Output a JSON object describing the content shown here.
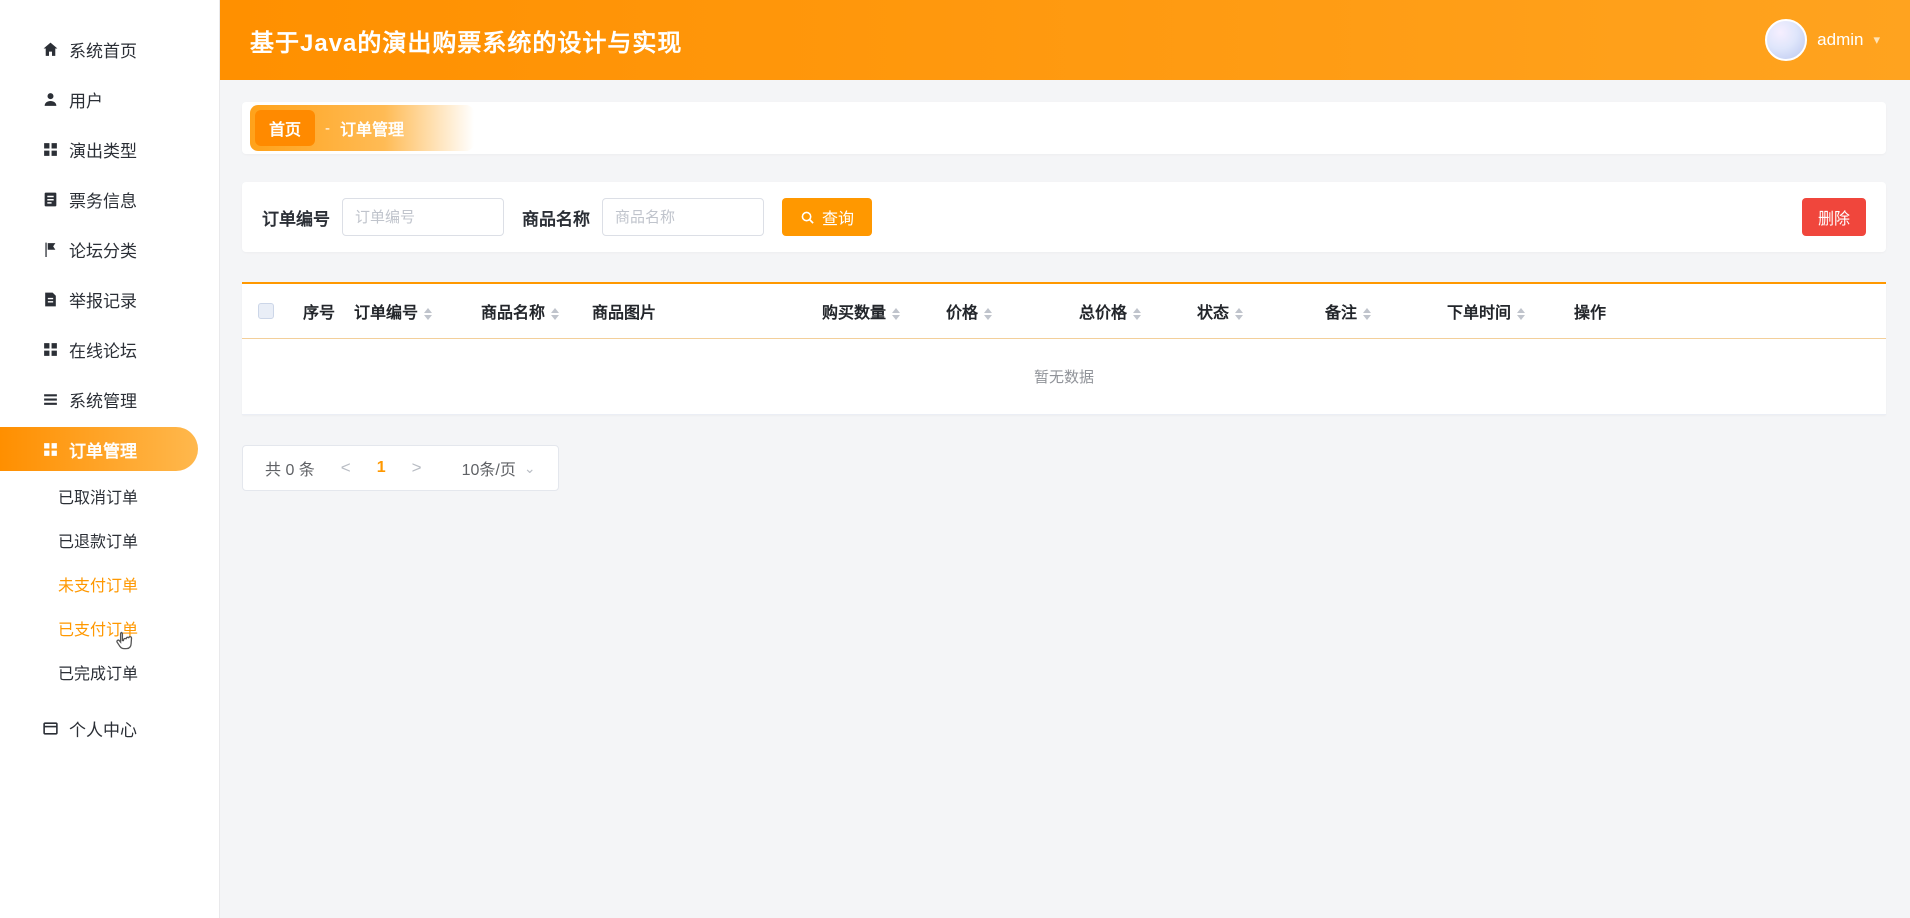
{
  "colors": {
    "accent": "#ff9800",
    "danger": "#f0463c"
  },
  "header": {
    "title": "基于Java的演出购票系统的设计与实现",
    "username": "admin"
  },
  "sidebar": {
    "items": [
      {
        "label": "系统首页",
        "icon": "home"
      },
      {
        "label": "用户",
        "icon": "user"
      },
      {
        "label": "演出类型",
        "icon": "grid"
      },
      {
        "label": "票务信息",
        "icon": "ticket"
      },
      {
        "label": "论坛分类",
        "icon": "flag"
      },
      {
        "label": "举报记录",
        "icon": "report"
      },
      {
        "label": "在线论坛",
        "icon": "forum"
      },
      {
        "label": "系统管理",
        "icon": "system"
      },
      {
        "label": "订单管理",
        "icon": "order",
        "active": true
      },
      {
        "label": "个人中心",
        "icon": "profile"
      }
    ],
    "order_submenu": [
      {
        "label": "已取消订单",
        "highlighted": false
      },
      {
        "label": "已退款订单",
        "highlighted": false
      },
      {
        "label": "未支付订单",
        "highlighted": true
      },
      {
        "label": "已支付订单",
        "highlighted": true
      },
      {
        "label": "已完成订单",
        "highlighted": false
      }
    ]
  },
  "breadcrumb": {
    "home": "首页",
    "separator": "-",
    "current": "订单管理"
  },
  "filters": {
    "order_no_label": "订单编号",
    "order_no_placeholder": "订单编号",
    "product_name_label": "商品名称",
    "product_name_placeholder": "商品名称",
    "search_button": "查询",
    "delete_button": "删除"
  },
  "table": {
    "columns": [
      "序号",
      "订单编号",
      "商品名称",
      "商品图片",
      "购买数量",
      "价格",
      "总价格",
      "状态",
      "备注",
      "下单时间",
      "操作"
    ],
    "empty_text": "暂无数据"
  },
  "pagination": {
    "total_text": "共 0 条",
    "prev": "<",
    "current_page": "1",
    "next": ">",
    "page_size": "10条/页"
  }
}
